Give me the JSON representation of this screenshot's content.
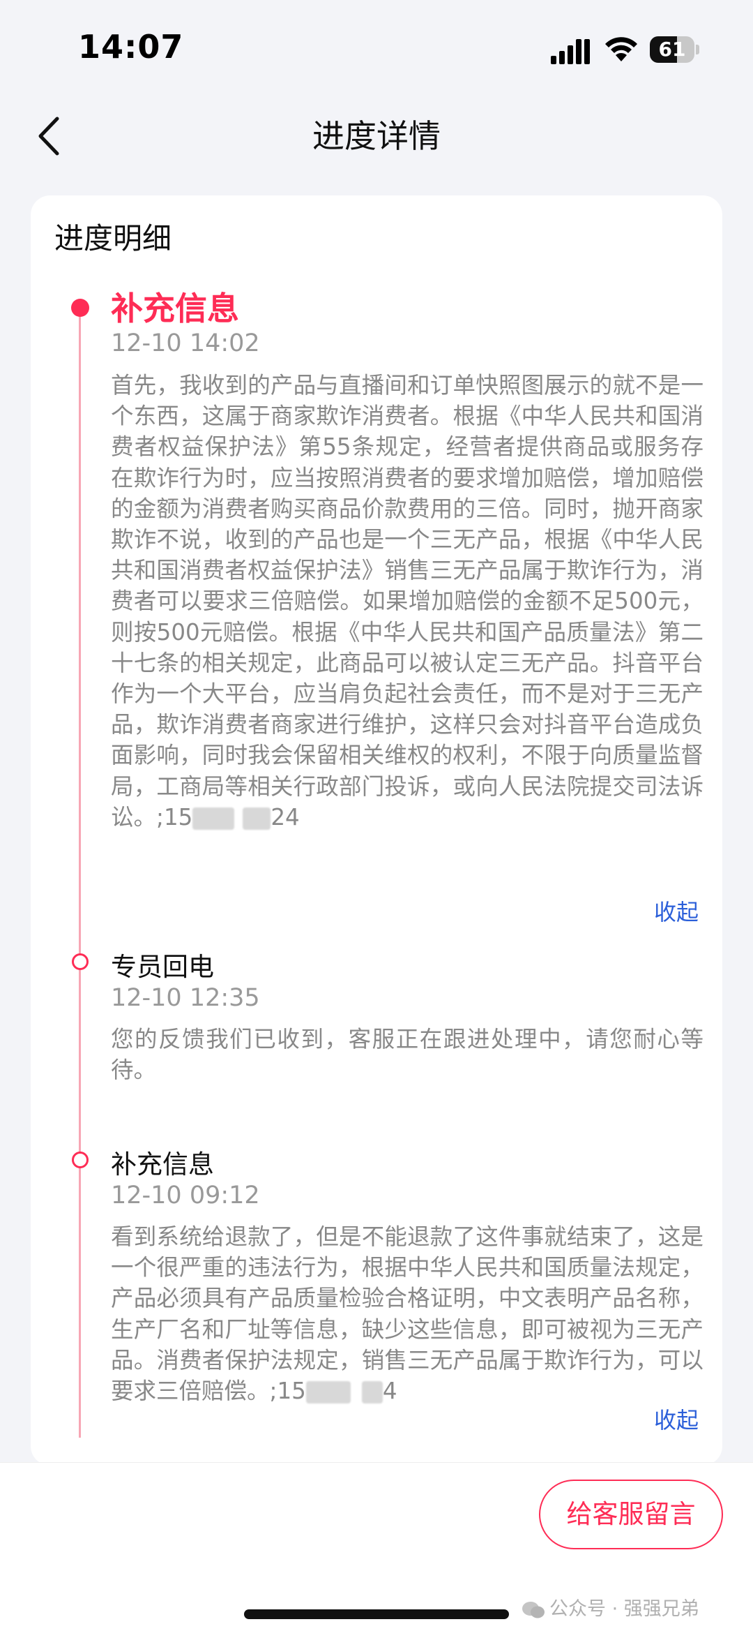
{
  "status": {
    "time": "14:07",
    "battery": "61",
    "battery_level": 0.61
  },
  "nav": {
    "title": "进度详情"
  },
  "card": {
    "title": "进度明细"
  },
  "entries": [
    {
      "title": "补充信息",
      "time": "12-10 14:02",
      "text_main": "首先，我收到的产品与直播间和订单快照图展示的就不是一个东西，这属于商家欺诈消费者。根据《中华人民共和国消费者权益保护法》第55条规定，经营者提供商品或服务存在欺诈行为时，应当按照消费者的要求增加赔偿，增加赔偿的金额为消费者购买商品价款费用的三倍。同时，抛开商家欺诈不说，收到的产品也是一个三无产品，根据《中华人民共和国消费者权益保护法》销售三无产品属于欺诈行为，消费者可以要求三倍赔偿。如果增加赔偿的金额不足500元，则按500元赔偿。根据《中华人民共和国产品质量法》第二十七条的相关规定，此商品可以被认定三无产品。抖音平台作为一个大平台，应当肩负起社会责任，而不是对于三无产品，欺诈消费者商家进行维护，这样只会对抖音平台造成负面影响，同时我会保留相关维权的权利，不限于向质量监督局，工商局等相关行政部门投诉，或向人民法院提交司法诉讼。;15",
      "text_tail": "24",
      "collapse": "收起"
    },
    {
      "title": "专员回电",
      "time": "12-10 12:35",
      "text_main": "您的反馈我们已收到，客服正在跟进处理中，请您耐心等待。"
    },
    {
      "title": "补充信息",
      "time": "12-10 09:12",
      "text_main": "看到系统给退款了，但是不能退款了这件事就结束了，这是一个很严重的违法行为，根据中华人民共和国质量法规定，产品必须具有产品质量检验合格证明，中文表明产品名称，生产厂名和厂址等信息，缺少这些信息，即可被视为三无产品。消费者保护法规定，销售三无产品属于欺诈行为，可以要求三倍赔偿。;15",
      "text_tail": "4",
      "collapse": "收起"
    }
  ],
  "bottom": {
    "button": "给客服留言",
    "watermark": "公众号 · 强强兄弟"
  },
  "colors": {
    "accent": "#fe2c55",
    "link": "#2b5fd9",
    "bg": "#f3f4f8"
  }
}
